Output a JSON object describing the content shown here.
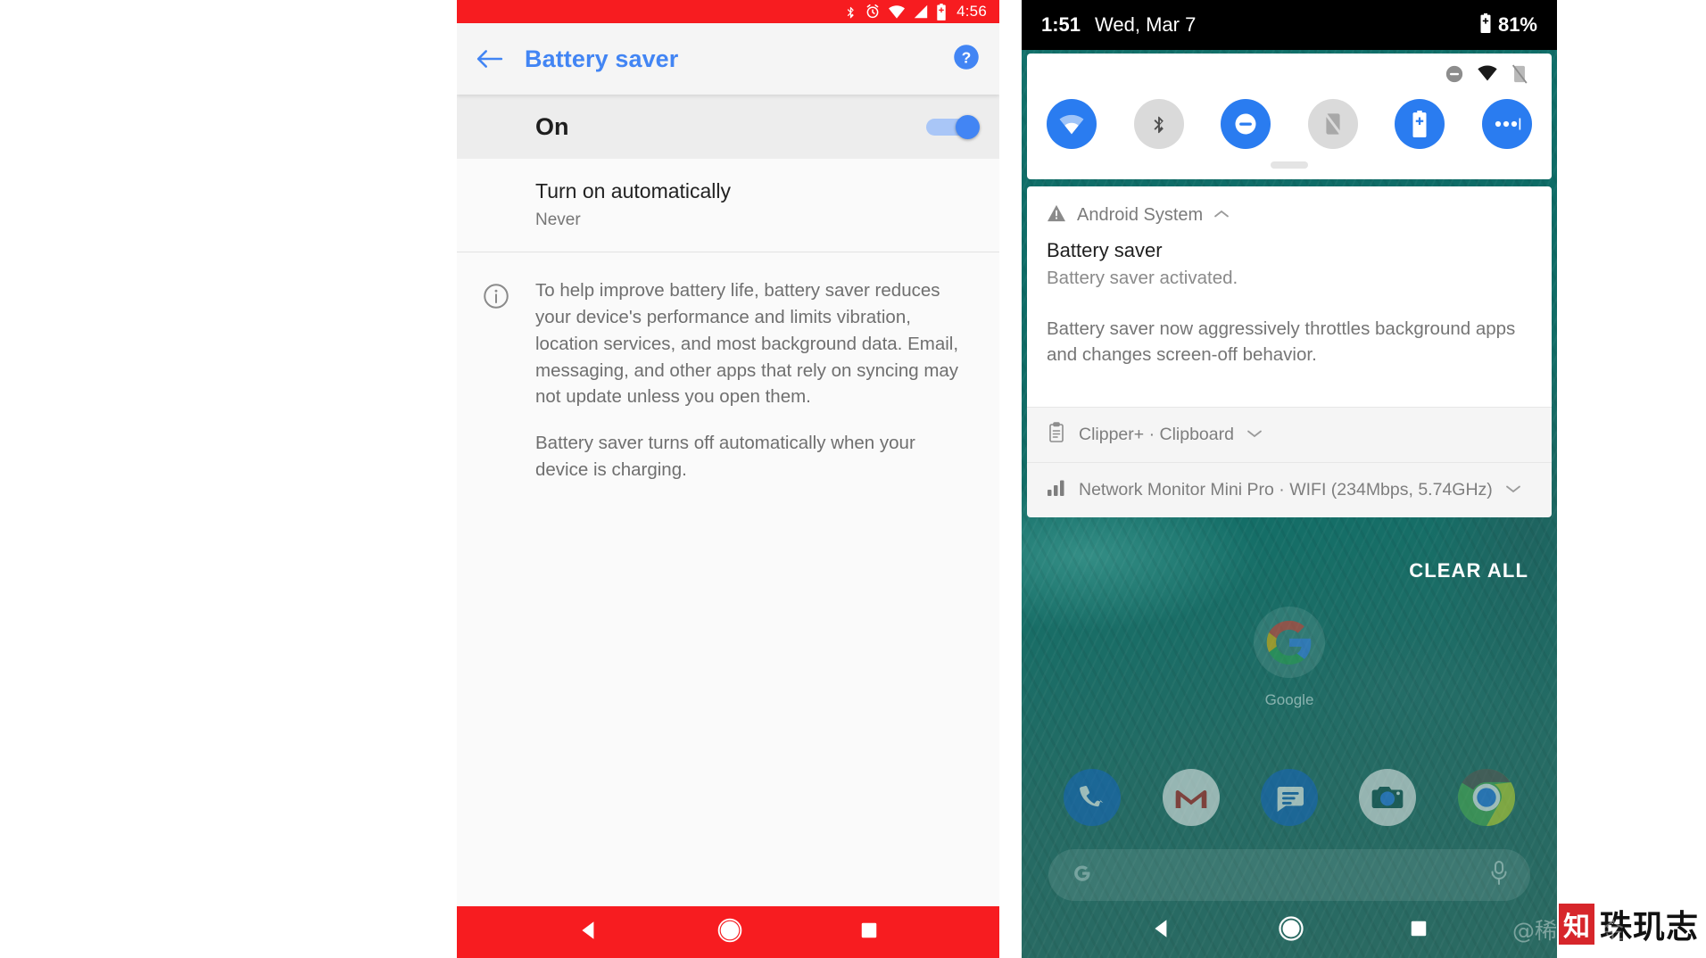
{
  "colors": {
    "left_accent_red": "#F71C20",
    "title_blue": "#4285F4",
    "tile_on_blue": "#2A7CF0",
    "tile_off_gray": "#DADADA",
    "wallpaper_teal": "#13726C"
  },
  "left_phone": {
    "status_bar": {
      "icons": [
        "bluetooth-icon",
        "alarm-icon",
        "wifi-icon",
        "signal-icon",
        "battery-saver-icon"
      ],
      "time": "4:56"
    },
    "app_bar": {
      "back_icon": "back-arrow-icon",
      "title": "Battery saver",
      "help_icon": "help-icon"
    },
    "toggle_row": {
      "label": "On",
      "state": "on"
    },
    "auto_row": {
      "title": "Turn on automatically",
      "value": "Never"
    },
    "info": {
      "icon": "info-icon",
      "paragraphs": [
        "To help improve battery life, battery saver reduces your device's performance and limits vibration, location services, and most background data. Email, messaging, and other apps that rely on syncing may not update unless you open them.",
        "Battery saver turns off automatically when your device is charging."
      ]
    },
    "nav_bar": {
      "back": "back-triangle-icon",
      "home": "home-circle-icon",
      "recents": "recents-square-icon"
    }
  },
  "right_phone": {
    "status_bar": {
      "time": "1:51",
      "date": "Wed, Mar 7",
      "battery_icon": "battery-saver-icon",
      "battery_percent": "81%"
    },
    "quick_settings": {
      "status_icons": [
        "dnd-icon",
        "wifi-icon",
        "rotation-locked-icon"
      ],
      "tiles": [
        {
          "name": "wifi-tile",
          "icon": "wifi-icon",
          "state": "on"
        },
        {
          "name": "bluetooth-tile",
          "icon": "bluetooth-icon",
          "state": "off"
        },
        {
          "name": "do-not-disturb-tile",
          "icon": "dnd-icon",
          "state": "on"
        },
        {
          "name": "auto-rotate-tile",
          "icon": "rotation-locked-icon",
          "state": "off"
        },
        {
          "name": "battery-saver-tile",
          "icon": "battery-saver-icon",
          "state": "on"
        },
        {
          "name": "expand-tile",
          "icon": "more-dots-icon",
          "state": "on"
        }
      ],
      "handle": "drag-handle"
    },
    "notifications": [
      {
        "app": "Android System",
        "app_icon": "warning-triangle-icon",
        "collapse_icon": "chevron-up-icon",
        "title": "Battery saver",
        "text": "Battery saver activated.",
        "big_text": "Battery saver now aggressively throttles background apps and changes screen-off behavior."
      }
    ],
    "compact_notifications": [
      {
        "icon": "clipboard-icon",
        "text": "Clipper+ · Clipboard",
        "expand_icon": "chevron-down-icon"
      },
      {
        "icon": "signal-bars-icon",
        "text": "Network Monitor Mini Pro · WIFI  (234Mbps, 5.74GHz)",
        "expand_icon": "chevron-down-icon"
      }
    ],
    "clear_all_label": "CLEAR ALL",
    "google_widget": {
      "icon": "google-g-icon",
      "label": "Google"
    },
    "dock": [
      {
        "name": "phone-app-icon",
        "label": "Phone"
      },
      {
        "name": "gmail-app-icon",
        "label": "Gmail"
      },
      {
        "name": "messages-app-icon",
        "label": "Messages"
      },
      {
        "name": "camera-app-icon",
        "label": "Camera"
      },
      {
        "name": "chrome-app-icon",
        "label": "Chrome"
      }
    ],
    "search_bar": {
      "leading_icon": "google-g-icon",
      "placeholder": "",
      "mic_icon": "microphone-icon"
    },
    "nav_bar": {
      "back": "back-triangle-icon",
      "home": "home-circle-icon",
      "recents": "recents-square-icon"
    }
  },
  "watermark": {
    "faint_text": "@稀土掘金",
    "logo_glyph": "知",
    "text": "珠玑志"
  }
}
